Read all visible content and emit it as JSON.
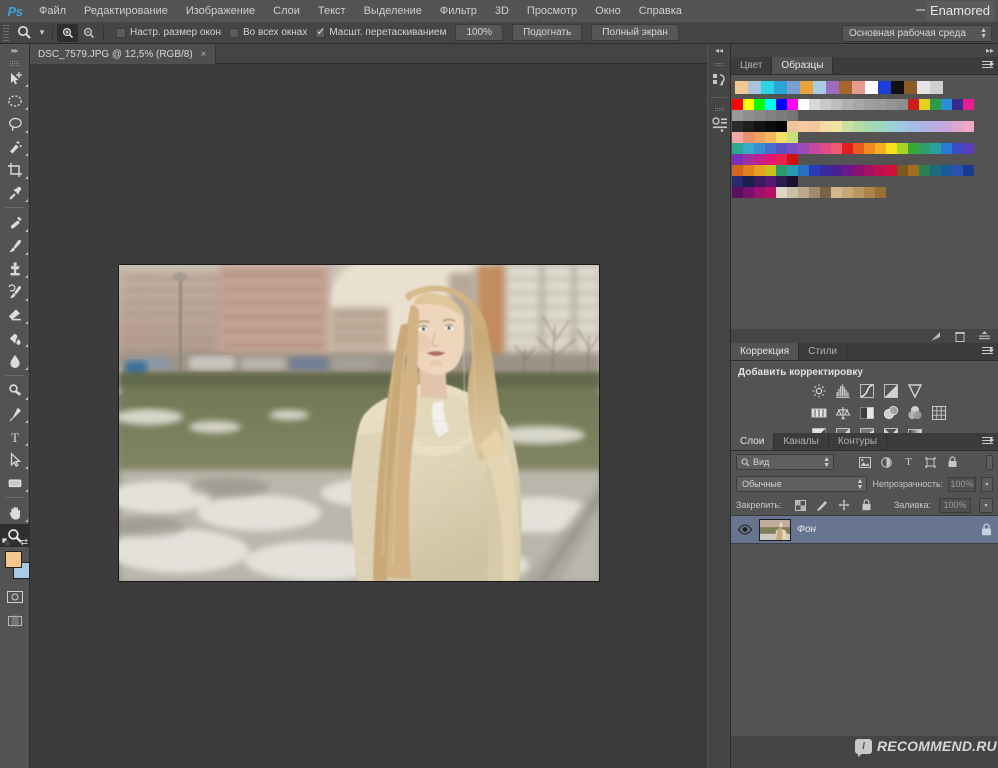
{
  "app": {
    "logo": "Ps",
    "window_label": "Enamored",
    "close_glyph": "×"
  },
  "menubar": {
    "items": [
      {
        "label": "Файл"
      },
      {
        "label": "Редактирование"
      },
      {
        "label": "Изображение"
      },
      {
        "label": "Слои"
      },
      {
        "label": "Текст"
      },
      {
        "label": "Выделение"
      },
      {
        "label": "Фильтр"
      },
      {
        "label": "3D"
      },
      {
        "label": "Просмотр"
      },
      {
        "label": "Окно"
      },
      {
        "label": "Справка"
      }
    ]
  },
  "options_bar": {
    "active_tool_icon": "zoom-tool-icon",
    "zoom_in_icon": "zoom-in-icon",
    "zoom_out_icon": "zoom-out-icon",
    "checkboxes": [
      {
        "label": "Настр. размер окон",
        "checked": false
      },
      {
        "label": "Во всех окнах",
        "checked": false
      },
      {
        "label": "Масшт. перетаскиванием",
        "checked": true
      }
    ],
    "buttons": [
      {
        "label": "100%"
      },
      {
        "label": "Подогнать"
      },
      {
        "label": "Полный экран"
      }
    ],
    "workspace": {
      "label": "Основная рабочая среда"
    }
  },
  "document_tab": {
    "title": "DSC_7579.JPG @ 12,5% (RGB/8)",
    "close": "×"
  },
  "toolbar": {
    "tools": [
      {
        "name": "move-tool",
        "icon": "move-icon",
        "has_flyout": true,
        "selected": false
      },
      {
        "name": "marquee-tool",
        "icon": "elliptical-marquee-icon",
        "has_flyout": true,
        "selected": false
      },
      {
        "name": "lasso-tool",
        "icon": "lasso-icon",
        "has_flyout": true,
        "selected": false
      },
      {
        "name": "quick-selection-tool",
        "icon": "quick-selection-icon",
        "has_flyout": true,
        "selected": false
      },
      {
        "name": "crop-tool",
        "icon": "crop-icon",
        "has_flyout": true,
        "selected": false
      },
      {
        "name": "eyedropper-tool",
        "icon": "eyedropper-icon",
        "has_flyout": true,
        "selected": false
      },
      {
        "name": "healing-brush-tool",
        "icon": "healing-brush-icon",
        "has_flyout": true,
        "selected": false
      },
      {
        "name": "brush-tool",
        "icon": "brush-icon",
        "has_flyout": true,
        "selected": false
      },
      {
        "name": "clone-stamp-tool",
        "icon": "clone-stamp-icon",
        "has_flyout": true,
        "selected": false
      },
      {
        "name": "history-brush-tool",
        "icon": "history-brush-icon",
        "has_flyout": true,
        "selected": false
      },
      {
        "name": "eraser-tool",
        "icon": "eraser-icon",
        "has_flyout": true,
        "selected": false
      },
      {
        "name": "gradient-tool",
        "icon": "paint-bucket-icon",
        "has_flyout": true,
        "selected": false
      },
      {
        "name": "blur-tool",
        "icon": "blur-drop-icon",
        "has_flyout": true,
        "selected": false
      },
      {
        "name": "dodge-tool",
        "icon": "dodge-icon",
        "has_flyout": true,
        "selected": false
      },
      {
        "name": "pen-tool",
        "icon": "pen-icon",
        "has_flyout": true,
        "selected": false
      },
      {
        "name": "type-tool",
        "icon": "type-t-icon",
        "has_flyout": true,
        "selected": false
      },
      {
        "name": "path-selection-tool",
        "icon": "path-arrow-icon",
        "has_flyout": true,
        "selected": false
      },
      {
        "name": "rectangle-tool",
        "icon": "rectangle-shape-icon",
        "has_flyout": true,
        "selected": false
      },
      {
        "name": "hand-tool",
        "icon": "hand-icon",
        "has_flyout": true,
        "selected": false
      },
      {
        "name": "zoom-tool",
        "icon": "magnifier-icon",
        "has_flyout": false,
        "selected": true
      }
    ],
    "foreground_color": "#f3c78d",
    "background_color": "#a8cbe8",
    "quick_mask_icon": "quick-mask-icon",
    "screen_mode_icon": "screen-mode-icon"
  },
  "icon_dock": {
    "items": [
      {
        "name": "history-panel-icon"
      },
      {
        "name": "properties-panel-icon"
      }
    ]
  },
  "color_panel": {
    "tabs": [
      {
        "label": "Цвет",
        "active": false
      },
      {
        "label": "Образцы",
        "active": true
      }
    ],
    "recent_swatches": [
      "#f0c896",
      "#a9c3dd",
      "#2fd4e4",
      "#2aa5d6",
      "#7b9fd0",
      "#e8a33d",
      "#a8cbe8",
      "#9b6cc0",
      "#a9662b",
      "#e59a92",
      "#ffffff",
      "#1b3fd4",
      "#101010",
      "#8a5a28",
      "#e4e4e4",
      "#cfcfcf"
    ],
    "swatch_rows": [
      [
        "#ff0000",
        "#ffff00",
        "#00ff00",
        "#00ffff",
        "#0000ff",
        "#ff00ff",
        "#ffffff",
        "#d8d8d8",
        "#c8c8c8",
        "#bdbdbd",
        "#b0b0b0",
        "#a8a8a8",
        "#a0a0a0",
        "#9b9b9b",
        "#949494",
        "#8d8d8d",
        "#ce1b1b",
        "#e8d020",
        "#2a9d4a",
        "#2a8fd6",
        "#3a2a8c",
        "#e91e8c",
        "#999999",
        "#8f8f8f",
        "#888888",
        "#828282",
        "#7c7c7c",
        "#767676"
      ],
      [
        "#2b2b2b",
        "#1e1e1e",
        "#131313",
        "#0b0b0b",
        "#050505",
        "#f0c49a",
        "#f6c9a2",
        "#f2c79a",
        "#f6d9a8",
        "#f0e6a0",
        "#c9e0a0",
        "#b6dca6",
        "#a8d8b0",
        "#9fd6c0",
        "#9bd0d8",
        "#9cc8e2",
        "#a4bde4",
        "#b0b4e2",
        "#bcaee0",
        "#c6a8dc",
        "#e0a6d0",
        "#f0a8c4",
        "#f2a8a4",
        "#e88f6c",
        "#efa25f",
        "#f0b85f",
        "#f6e06a",
        "#c6e07a"
      ],
      [
        "#2aa98c",
        "#3aa8c8",
        "#3a8fd0",
        "#4a6ed0",
        "#5b52c0",
        "#7a4ec0",
        "#9b4cb8",
        "#c44aa0",
        "#e04a88",
        "#f05a70",
        "#e02020",
        "#e85a20",
        "#f08a20",
        "#f2b020",
        "#f6e020",
        "#a8d428",
        "#3aa838",
        "#29a06a",
        "#2aa0a0",
        "#2a7ad0",
        "#3b4ec8",
        "#5b3ec0",
        "#7a30b8",
        "#a030a0",
        "#c02090",
        "#e01870",
        "#e82050",
        "#d01010"
      ],
      [
        "#d2661e",
        "#e08020",
        "#e8a020",
        "#c8c020",
        "#2a9a6a",
        "#2a9ab0",
        "#2a70c0",
        "#2a3ab8",
        "#3a2aa0",
        "#4a2090",
        "#6b1888",
        "#8b1070",
        "#a81060",
        "#c01050",
        "#d01040",
        "#7a5a20",
        "#a07020",
        "#2a8050",
        "#206a80",
        "#1a5a9a",
        "#2a50b0",
        "#1a3a90",
        "#2a2a70",
        "#1a2050",
        "#3a1a60",
        "#501a70",
        "#2a1a50",
        "#1a1030"
      ],
      [
        "#5a1060",
        "#7a1070",
        "#a01070",
        "#b81060",
        "#dcd6c6",
        "#cbbfa8",
        "#bca88a",
        "#a08a6a",
        "#7a6448",
        "#d2b88c",
        "#c8a878",
        "#bc9860",
        "#ae8448",
        "#9a7038"
      ]
    ]
  },
  "adjustments_panel": {
    "tabs": [
      {
        "label": "Коррекция",
        "active": true
      },
      {
        "label": "Стили",
        "active": false
      }
    ],
    "title": "Добавить корректировку",
    "rows": [
      [
        "brightness-contrast-icon",
        "levels-icon",
        "curves-icon",
        "exposure-icon",
        "vibrance-icon"
      ],
      [
        "hue-saturation-icon",
        "color-balance-icon",
        "black-white-icon",
        "photo-filter-icon",
        "channel-mixer-icon",
        "color-lookup-icon"
      ],
      [
        "invert-icon",
        "posterize-icon",
        "threshold-icon",
        "selective-color-icon",
        "gradient-map-icon"
      ]
    ],
    "footer_icons": [
      "new-adjustment-icon",
      "delete-icon",
      "expand-icon"
    ]
  },
  "layers_panel": {
    "tabs": [
      {
        "label": "Слои",
        "active": true
      },
      {
        "label": "Каналы",
        "active": false
      },
      {
        "label": "Контуры",
        "active": false
      }
    ],
    "filter": {
      "label": "Вид",
      "icon": "search-icon",
      "type_icons": [
        "pixel-layer-icon",
        "adjustment-layer-icon",
        "type-layer-icon",
        "shape-layer-icon",
        "smart-object-icon"
      ]
    },
    "blend_mode": "Обычные",
    "opacity_label": "Непрозрачность:",
    "opacity_value": "100%",
    "lock_label": "Закрепить:",
    "lock_icons": [
      "lock-transparent-icon",
      "lock-image-icon",
      "lock-position-icon",
      "lock-all-icon"
    ],
    "fill_label": "Заливка:",
    "fill_value": "100%",
    "layers": [
      {
        "name": "Фон",
        "visible": true,
        "locked": true,
        "selected": true,
        "visibility_icon": "eye-icon",
        "lock_icon": "lock-icon"
      }
    ]
  },
  "canvas": {
    "photo_alt": "blonde-woman-in-cream-knit-sweater-outdoors",
    "zoom_level": "12,5%"
  },
  "watermark": {
    "logo_letter": "I",
    "text": "RECOMMEND.RU"
  }
}
